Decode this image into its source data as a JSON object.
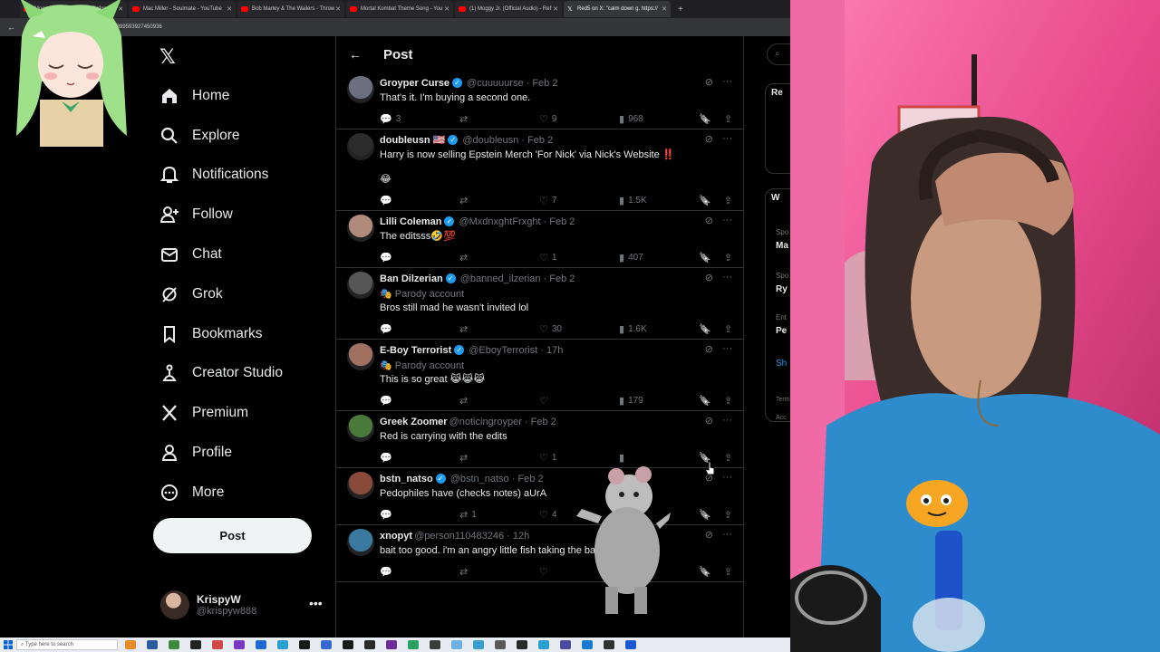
{
  "browser": {
    "tabs": [
      {
        "title": "Moggy Jr. (Official A... - Reform",
        "icon": "youtube-icon"
      },
      {
        "title": "Mac Miller - Soulmate - YouTube",
        "icon": "youtube-icon"
      },
      {
        "title": "Bob Marley & The Wailers - Throw",
        "icon": "youtube-icon"
      },
      {
        "title": "Mortal Kombat Theme Song - You",
        "icon": "youtube-icon"
      },
      {
        "title": "(1) Moggy Jr. (Official Audio) - Ref",
        "icon": "youtube-icon"
      },
      {
        "title": "Red5 on X: \"calm down g. https://",
        "icon": "x-icon",
        "active": true
      }
    ],
    "url": "x.com/i/status/2018399593927450936"
  },
  "sidebar": {
    "items": [
      {
        "label": "Home",
        "icon": "home-icon"
      },
      {
        "label": "Explore",
        "icon": "search-icon"
      },
      {
        "label": "Notifications",
        "icon": "bell-icon"
      },
      {
        "label": "Follow",
        "icon": "follow-icon"
      },
      {
        "label": "Chat",
        "icon": "mail-icon"
      },
      {
        "label": "Grok",
        "icon": "grok-icon"
      },
      {
        "label": "Bookmarks",
        "icon": "bookmark-icon"
      },
      {
        "label": "Creator Studio",
        "icon": "creator-icon"
      },
      {
        "label": "Premium",
        "icon": "x-icon"
      },
      {
        "label": "Profile",
        "icon": "person-icon"
      },
      {
        "label": "More",
        "icon": "more-circle-icon"
      }
    ],
    "post_label": "Post",
    "user": {
      "name": "KrispyW",
      "handle": "@krispyw888"
    }
  },
  "header": {
    "title": "Post"
  },
  "tweets": [
    {
      "name": "Groyper Curse",
      "verified": true,
      "flag": "",
      "handle": "@cuuuuurse · Feb 2",
      "parody": "",
      "text": "That's it. I'm buying a second one.",
      "extra": "",
      "replies": "3",
      "reposts": "",
      "likes": "9",
      "views": "968",
      "avatar_color": "#6b6f80"
    },
    {
      "name": "doubleusn",
      "verified": true,
      "flag": "🇺🇸",
      "handle": "@doubleusn · Feb 2",
      "parody": "",
      "text": "Harry is now selling Epstein Merch 'For Nick' via Nick's Website ‼️",
      "extra": "😂",
      "replies": "",
      "reposts": "",
      "likes": "7",
      "views": "1.5K",
      "avatar_color": "#2b2b2b"
    },
    {
      "name": "Lilli Coleman",
      "verified": true,
      "flag": "",
      "handle": "@MxdnxghtFrxght · Feb 2",
      "parody": "",
      "text": "The editsss🤣💯",
      "extra": "",
      "replies": "",
      "reposts": "",
      "likes": "1",
      "views": "407",
      "avatar_color": "#b08a7a"
    },
    {
      "name": "Ban Dilzerian",
      "verified": true,
      "flag": "",
      "handle": "@banned_ilzerian · Feb 2",
      "parody": "Parody account",
      "text": "Bros still mad he wasn't invited lol",
      "extra": "",
      "replies": "",
      "reposts": "",
      "likes": "30",
      "views": "1.6K",
      "avatar_color": "#555555"
    },
    {
      "name": "E-Boy Terrorist",
      "verified": true,
      "flag": "",
      "handle": "@EboyTerrorist · 17h",
      "parody": "Parody account",
      "text": "This is so great 😹😹😹",
      "extra": "",
      "replies": "",
      "reposts": "",
      "likes": "",
      "views": "179",
      "avatar_color": "#a07060"
    },
    {
      "name": "Greek Zoomer",
      "verified": false,
      "flag": "",
      "handle": "@noticingroyper · Feb 2",
      "parody": "",
      "text": "Red is carrying with the edits",
      "extra": "",
      "replies": "",
      "reposts": "",
      "likes": "1",
      "views": "",
      "avatar_color": "#4a7a3a"
    },
    {
      "name": "bstn_natso",
      "verified": true,
      "flag": "",
      "handle": "@bstn_natso · Feb 2",
      "parody": "",
      "text": "Pedophiles have (checks notes) aUrA",
      "extra": "",
      "replies": "",
      "reposts": "1",
      "likes": "4",
      "views": "",
      "avatar_color": "#8a4a3a"
    },
    {
      "name": "xnopyt",
      "verified": false,
      "flag": "",
      "handle": "@person110483246 · 12h",
      "parody": "",
      "text": "bait too good. i'm an angry little fish taking the bait.",
      "extra": "",
      "replies": "",
      "reposts": "",
      "likes": "",
      "views": "",
      "avatar_color": "#3a7aa0"
    }
  ],
  "rightcol": {
    "search_placeholder": "S",
    "box1_title": "Re",
    "box2_title": "W",
    "labels": [
      "Spo",
      "Ma",
      "Spo",
      "Ry",
      "Ent",
      "Pe",
      "Sh",
      "Term",
      "Acc"
    ]
  },
  "taskbar": {
    "search_placeholder": "Type here to search"
  },
  "colors": {
    "accent": "#1d9bf0",
    "background": "#000000",
    "border": "#2f3336",
    "muted": "#71767b"
  }
}
